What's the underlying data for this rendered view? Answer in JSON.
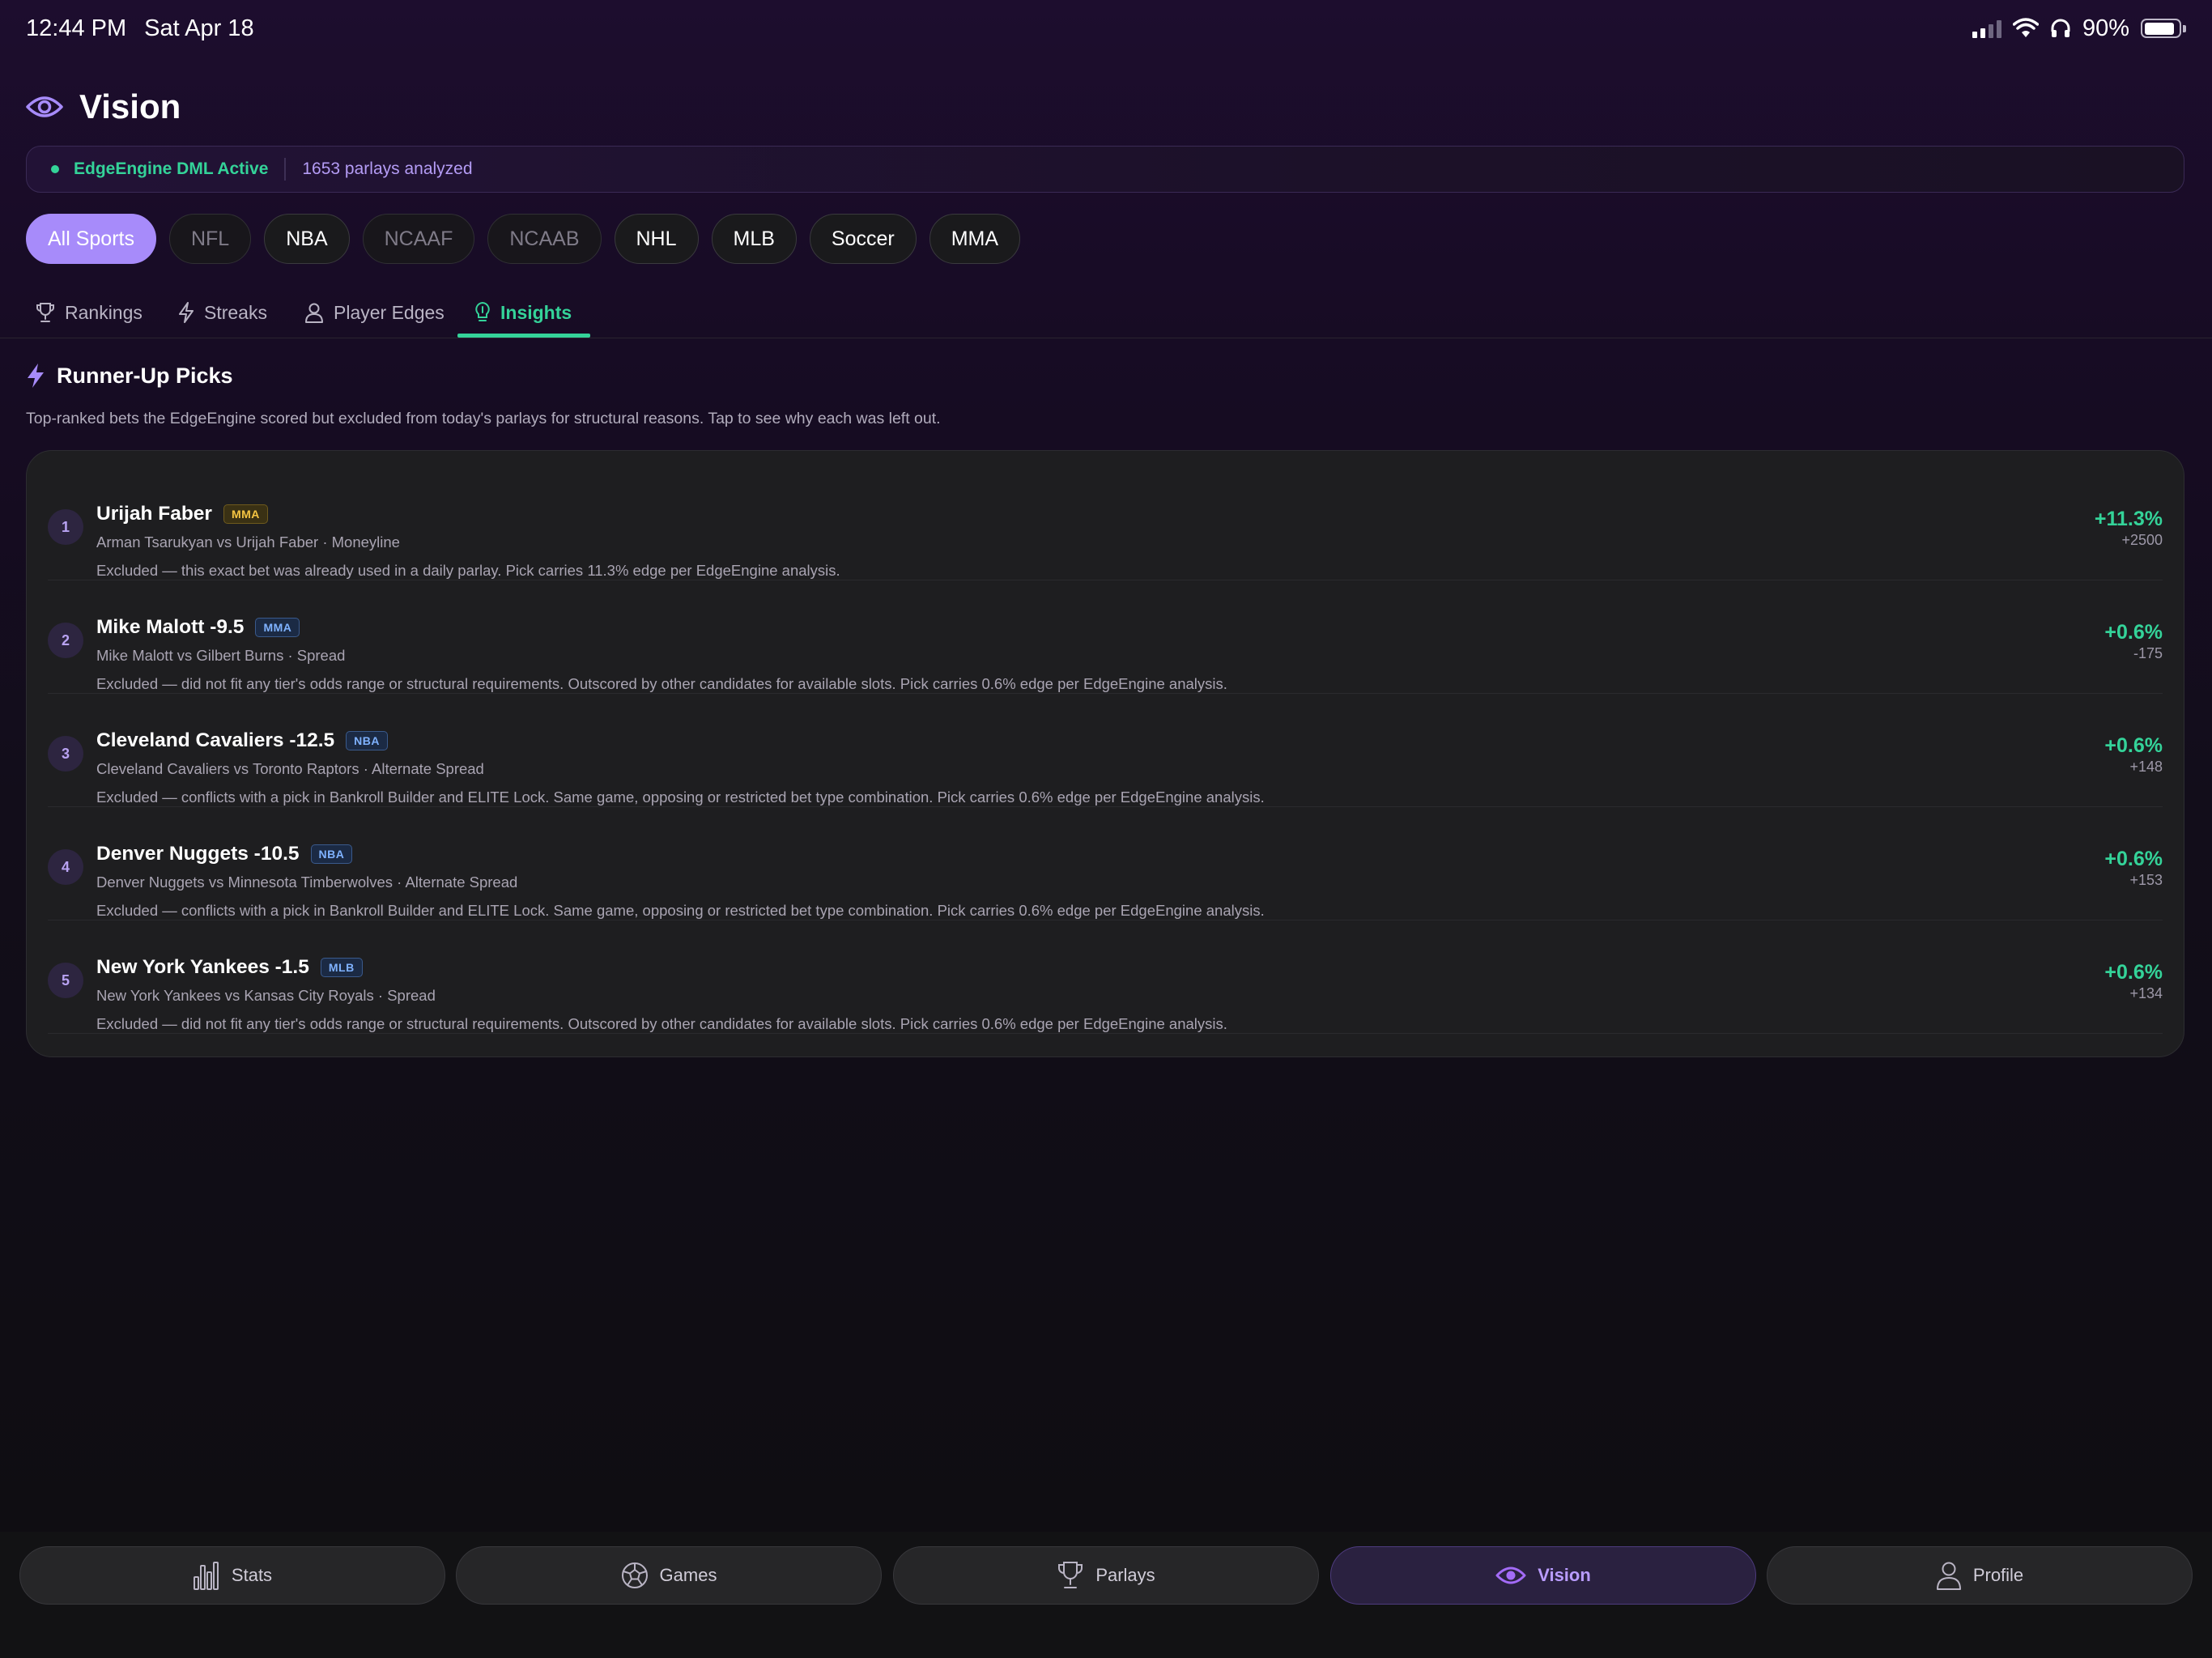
{
  "status_bar": {
    "time": "12:44 PM",
    "date": "Sat Apr 18",
    "battery": "90%",
    "battery_level": 0.9
  },
  "header": {
    "title": "Vision",
    "icon": "eye-icon"
  },
  "engine": {
    "status": "EdgeEngine DML Active",
    "parlays": "1653 parlays analyzed",
    "status_color": "#34d399"
  },
  "sports": [
    "All Sports",
    "NFL",
    "NBA",
    "NCAAF",
    "NCAAB",
    "NHL",
    "MLB",
    "Soccer",
    "MMA"
  ],
  "tabs": {
    "rankings": "Rankings",
    "streaks": "Streaks",
    "player_edges": "Player Edges",
    "insights": "Insights"
  },
  "section": {
    "title": "Runner-Up Picks",
    "description": "Top-ranked bets the EdgeEngine scored but excluded from today's parlays for structural reasons. Tap to see why each was left out."
  },
  "picks": [
    {
      "rank": "1",
      "name": "Urijah Faber",
      "league": "MMA",
      "matchup": "Arman Tsarukyan vs Urijah Faber · Moneyline",
      "reason": "Excluded — this exact bet was already used in a daily parlay. Pick carries 11.3% edge per EdgeEngine analysis.",
      "edge": "+11.3%",
      "odds": "+2500"
    },
    {
      "rank": "2",
      "name": "Mike Malott -9.5",
      "league": "MMA",
      "matchup": "Mike Malott vs Gilbert Burns · Spread",
      "reason": "Excluded — did not fit any tier's odds range or structural requirements. Outscored by other candidates for available slots. Pick carries 0.6% edge per EdgeEngine analysis.",
      "edge": "+0.6%",
      "odds": "-175"
    },
    {
      "rank": "3",
      "name": "Cleveland Cavaliers -12.5",
      "league": "NBA",
      "matchup": "Cleveland Cavaliers vs Toronto Raptors · Alternate Spread",
      "reason": "Excluded — conflicts with a pick in Bankroll Builder and ELITE Lock. Same game, opposing or restricted bet type combination. Pick carries 0.6% edge per EdgeEngine analysis.",
      "edge": "+0.6%",
      "odds": "+148"
    },
    {
      "rank": "4",
      "name": "Denver Nuggets -10.5",
      "league": "NBA",
      "matchup": "Denver Nuggets vs Minnesota Timberwolves · Alternate Spread",
      "reason": "Excluded — conflicts with a pick in Bankroll Builder and ELITE Lock. Same game, opposing or restricted bet type combination. Pick carries 0.6% edge per EdgeEngine analysis.",
      "edge": "+0.6%",
      "odds": "+153"
    },
    {
      "rank": "5",
      "name": "New York Yankees -1.5",
      "league": "MLB",
      "matchup": "New York Yankees vs Kansas City Royals · Spread",
      "reason": "Excluded — did not fit any tier's odds range or structural requirements. Outscored by other candidates for available slots. Pick carries 0.6% edge per EdgeEngine analysis.",
      "edge": "+0.6%",
      "odds": "+134"
    }
  ],
  "bottom_nav": {
    "stats": "Stats",
    "games": "Games",
    "parlays": "Parlays",
    "vision": "Vision",
    "profile": "Profile"
  },
  "colors": {
    "accent": "#a78bfa",
    "positive": "#34d399",
    "vision_active": "#b99cff"
  }
}
